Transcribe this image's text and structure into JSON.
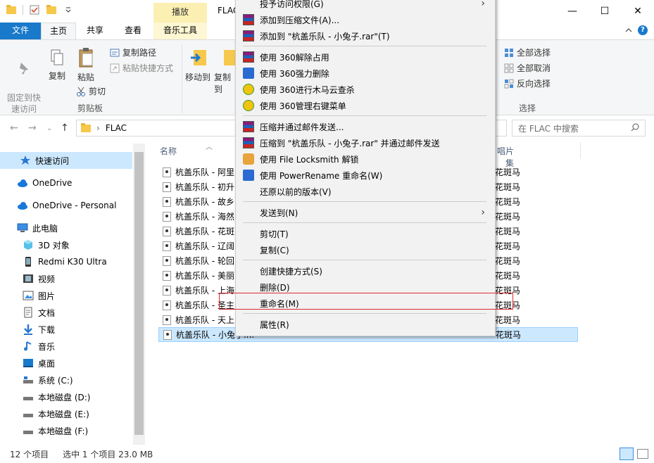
{
  "window": {
    "title": "FLAC",
    "context_tab": "播放",
    "minimize": "—",
    "maximize": "☐",
    "close": "✕"
  },
  "ribbon_tabs": [
    "文件",
    "主页",
    "共享",
    "查看",
    "音乐工具"
  ],
  "ribbon": {
    "pin": "固定到快\n速访问",
    "copy": "复制",
    "paste": "粘贴",
    "copy_path": "复制路径",
    "paste_shortcut": "粘贴快捷方式",
    "cut": "剪切",
    "clipboard_group": "剪贴板",
    "move_to": "移动到",
    "copy_to": "复制到",
    "select_all": "全部选择",
    "select_none": "全部取消",
    "invert": "反向选择",
    "select_group": "选择"
  },
  "address": {
    "path": "FLAC",
    "search_placeholder": "在 FLAC 中搜索"
  },
  "nav": [
    {
      "label": "快速访问",
      "icon": "star-icon"
    },
    {
      "label": "OneDrive",
      "icon": "cloud-icon"
    },
    {
      "label": "OneDrive - Personal",
      "icon": "cloud-icon"
    },
    {
      "label": "此电脑",
      "icon": "computer-icon"
    },
    {
      "label": "3D 对象",
      "icon": "cube-icon"
    },
    {
      "label": "Redmi K30 Ultra",
      "icon": "phone-icon"
    },
    {
      "label": "视频",
      "icon": "video-icon"
    },
    {
      "label": "图片",
      "icon": "picture-icon"
    },
    {
      "label": "文档",
      "icon": "document-icon"
    },
    {
      "label": "下载",
      "icon": "download-icon"
    },
    {
      "label": "音乐",
      "icon": "music-icon"
    },
    {
      "label": "桌面",
      "icon": "desktop-icon"
    },
    {
      "label": "系统 (C:)",
      "icon": "drive-icon"
    },
    {
      "label": "本地磁盘 (D:)",
      "icon": "drive-icon"
    },
    {
      "label": "本地磁盘 (E:)",
      "icon": "drive-icon"
    },
    {
      "label": "本地磁盘 (F:)",
      "icon": "drive-icon"
    }
  ],
  "columns": {
    "name": "名称",
    "album": "唱片集"
  },
  "files": [
    {
      "name": "杭盖乐队 - 阿里",
      "album": "花斑马"
    },
    {
      "name": "杭盖乐队 - 初升",
      "album": "花斑马"
    },
    {
      "name": "杭盖乐队 - 故乡",
      "album": "花斑马"
    },
    {
      "name": "杭盖乐队 - 海然",
      "album": "花斑马"
    },
    {
      "name": "杭盖乐队 - 花斑",
      "album": "花斑马"
    },
    {
      "name": "杭盖乐队 - 辽阔",
      "album": "花斑马"
    },
    {
      "name": "杭盖乐队 - 轮回",
      "album": "花斑马"
    },
    {
      "name": "杭盖乐队 - 美丽",
      "album": "花斑马"
    },
    {
      "name": "杭盖乐队 - 上海",
      "album": "花斑马"
    },
    {
      "name": "杭盖乐队 - 圣主",
      "album": "花斑马"
    },
    {
      "name": "杭盖乐队 - 天上",
      "album": "花斑马"
    },
    {
      "name": "杭盖乐队 - 小兔子.fl...",
      "album": "花斑马"
    }
  ],
  "status": {
    "count": "12 个项目",
    "selected": "选中 1 个项目  23.0 MB"
  },
  "menu": {
    "items": [
      {
        "label": "授予访问权限(G)",
        "icon": "",
        "arrow": "›"
      },
      {
        "label": "添加到压缩文件(A)...",
        "icon": "rar"
      },
      {
        "label": "添加到 \"杭盖乐队 - 小兔子.rar\"(T)",
        "icon": "rar"
      },
      {
        "label": "使用 360解除占用",
        "icon": "rar"
      },
      {
        "label": "使用 360强力删除",
        "icon": "pr"
      },
      {
        "label": "使用 360进行木马云查杀",
        "icon": "360"
      },
      {
        "label": "使用 360管理右键菜单",
        "icon": "360"
      },
      {
        "label": "压缩并通过邮件发送...",
        "icon": "rar"
      },
      {
        "label": "压缩到 \"杭盖乐队 - 小兔子.rar\" 并通过邮件发送",
        "icon": "rar"
      },
      {
        "label": "使用 File Locksmith 解锁",
        "icon": "lock"
      },
      {
        "label": "使用 PowerRename 重命名(W)",
        "icon": "pr"
      },
      {
        "label": "还原以前的版本(V)",
        "icon": ""
      },
      {
        "label": "发送到(N)",
        "icon": "",
        "arrow": "›"
      },
      {
        "label": "剪切(T)",
        "icon": ""
      },
      {
        "label": "复制(C)",
        "icon": ""
      },
      {
        "label": "创建快捷方式(S)",
        "icon": ""
      },
      {
        "label": "删除(D)",
        "icon": ""
      },
      {
        "label": "重命名(M)",
        "icon": ""
      },
      {
        "label": "属性(R)",
        "icon": ""
      }
    ]
  }
}
